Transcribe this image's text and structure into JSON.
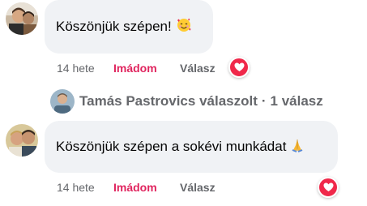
{
  "comments": [
    {
      "text": "Köszönjük szépen!",
      "emoji": "smiling-face-with-hearts",
      "time": "14 hete",
      "reaction_label": "Imádom",
      "reply_label": "Válasz",
      "reaction_icon": "heart-icon"
    },
    {
      "text": "Köszönjük szépen a sokévi munkádat",
      "emoji": "folded-hands",
      "time": "14 hete",
      "reaction_label": "Imádom",
      "reply_label": "Válasz",
      "reaction_icon": "heart-icon"
    }
  ],
  "replies_summary": {
    "author": "Tamás Pastrovics",
    "action": "válaszolt",
    "separator": "·",
    "count_label": "1 válasz"
  },
  "colors": {
    "bubble": "#f0f2f5",
    "reaction_text": "#e0245e",
    "heart_badge": "#f0284a",
    "meta_text": "#65676b"
  }
}
